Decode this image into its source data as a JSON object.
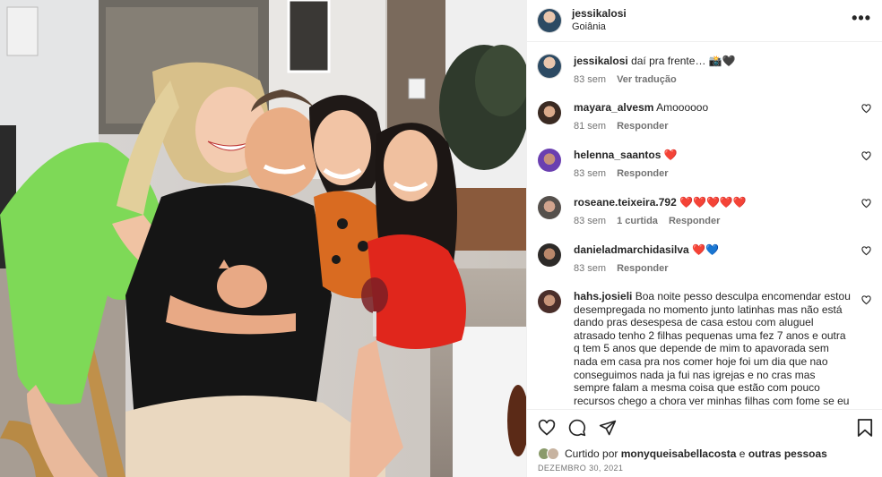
{
  "post": {
    "username": "jessikalosi",
    "location": "Goiânia",
    "more_icon": "more-horizontal-icon"
  },
  "caption": {
    "username": "jessikalosi",
    "text": "daí pra frente… 📸🖤",
    "time": "83 sem",
    "translate": "Ver tradução"
  },
  "comments": [
    {
      "username": "mayara_alvesm",
      "text": "Amoooooo",
      "time": "81 sem",
      "likes": "",
      "reply": "Responder"
    },
    {
      "username": "helenna_saantos",
      "text": "❤️",
      "time": "83 sem",
      "likes": "",
      "reply": "Responder"
    },
    {
      "username": "roseane.teixeira.792",
      "text": "❤️❤️❤️❤️❤️",
      "time": "83 sem",
      "likes": "1 curtida",
      "reply": "Responder"
    },
    {
      "username": "danieladmarchidasilva",
      "text": "❤️💙",
      "time": "83 sem",
      "likes": "",
      "reply": "Responder"
    },
    {
      "username": "hahs.josieli",
      "text": "Boa noite pesso desculpa encomendar estou desempregada no momento junto latinhas mas não está dando pras desespesa de casa estou com aluguel atrasado tenho 2 filhas pequenas uma fez 7 anos e outra q tem 5 anos que depende de mim to apavorada sem nada em casa pra nos comer hoje foi um dia que nao conseguimos nada ja fui nas igrejas e no cras mas sempre falam a mesma coisa que estão com pouco recursos chego a chora ver minhas filhas com fome se eu nao tivesse precisando nao teria me",
      "time": "",
      "likes": "",
      "reply": ""
    }
  ],
  "actions": {
    "like_icon": "heart-icon",
    "comment_icon": "comment-icon",
    "share_icon": "send-icon",
    "save_icon": "bookmark-icon"
  },
  "liked_by": {
    "prefix": "Curtido por",
    "user": "monyqueisabellacosta",
    "joiner": "e",
    "others": "outras pessoas"
  },
  "date": "DEZEMBRO 30, 2021",
  "colors": {
    "text": "#262626",
    "secondary": "#737373",
    "border": "#efefef",
    "heart_red": "#ed4956"
  }
}
